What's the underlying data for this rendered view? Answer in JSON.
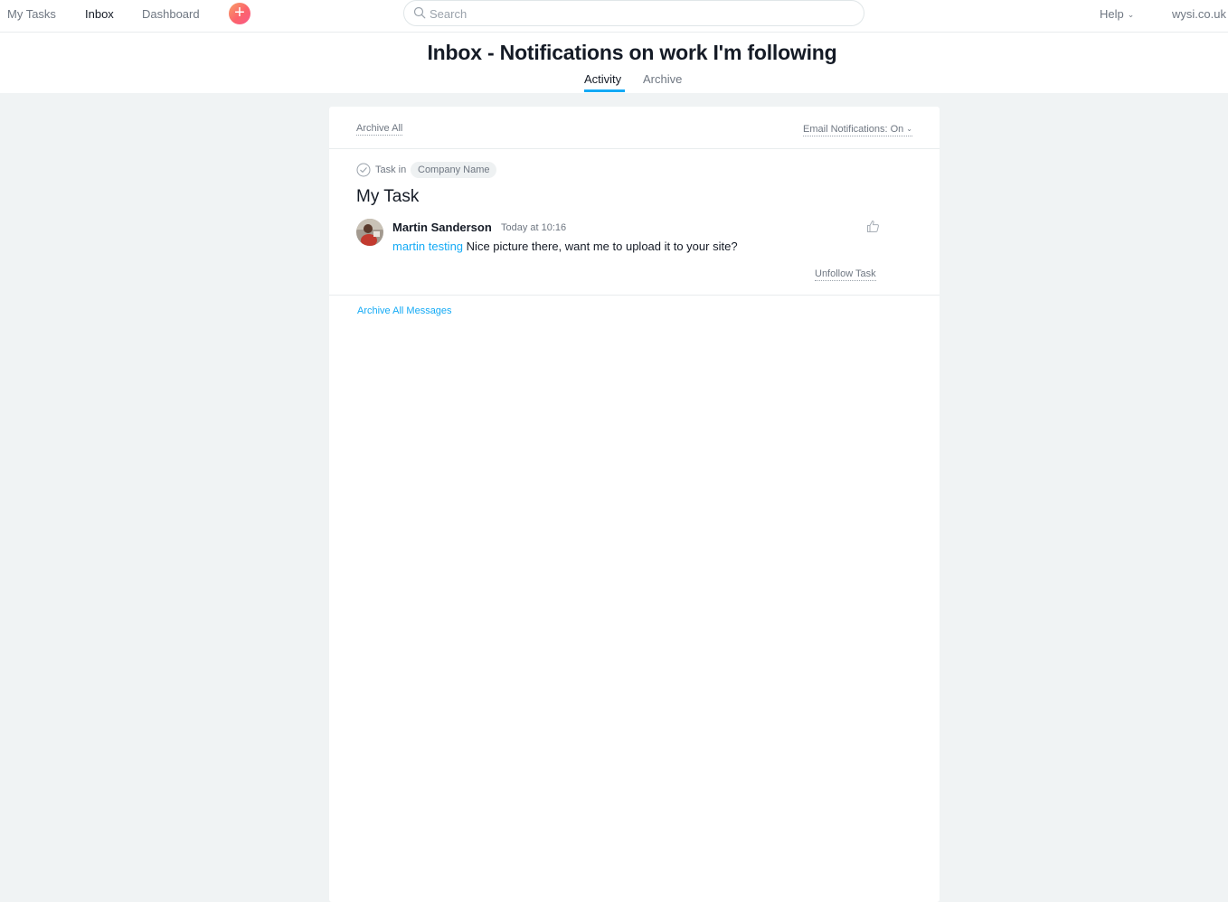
{
  "topbar": {
    "nav": [
      {
        "label": "My Tasks"
      },
      {
        "label": "Inbox"
      },
      {
        "label": "Dashboard"
      }
    ],
    "add_label": "+",
    "search": {
      "placeholder": "Search",
      "value": ""
    },
    "help_label": "Help",
    "org_label": "wysi.co.uk"
  },
  "header": {
    "title": "Inbox - Notifications on work I'm following",
    "tabs": [
      {
        "label": "Activity"
      },
      {
        "label": "Archive"
      }
    ]
  },
  "toolbar": {
    "archive_all": "Archive All",
    "email_notifications": "Email Notifications: On"
  },
  "notification": {
    "task_in": "Task in",
    "project": "Company Name",
    "task_title": "My Task",
    "author": "Martin Sanderson",
    "timestamp": "Today at 10:16",
    "mention": "martin testing",
    "message": "Nice picture there, want me to upload it to your site?",
    "unfollow": "Unfollow Task"
  },
  "footer": {
    "archive_all_messages": "Archive All Messages"
  },
  "colors": {
    "accent": "#14aaf5",
    "background": "#f0f3f4",
    "text": "#151b26",
    "muted": "#6f7782"
  },
  "icons": {
    "search": "search-icon",
    "check": "check-circle-icon",
    "like": "thumbs-up-icon",
    "chevron": "chevron-down-icon",
    "add": "plus-icon"
  }
}
